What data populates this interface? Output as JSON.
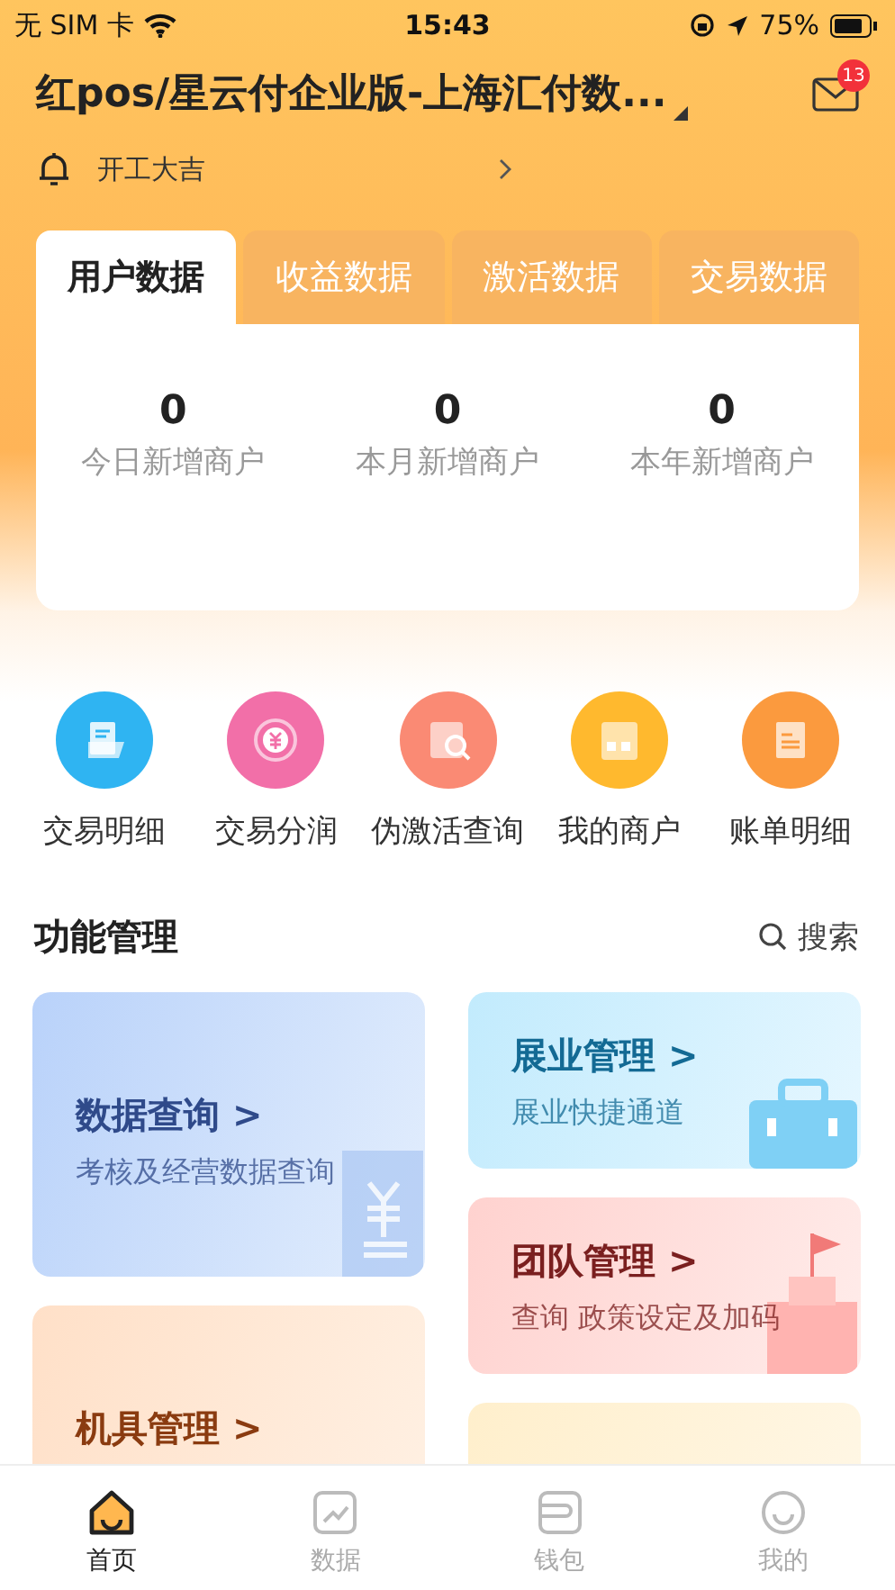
{
  "status_bar": {
    "carrier": "无 SIM 卡",
    "time": "15:43",
    "battery": "75%"
  },
  "header": {
    "title": "红pos/星云付企业版-上海汇付数...",
    "mail_badge": "13",
    "notice": "开工大吉"
  },
  "tabs": [
    {
      "label": "用户数据",
      "selected": true
    },
    {
      "label": "收益数据",
      "selected": false
    },
    {
      "label": "激活数据",
      "selected": false
    },
    {
      "label": "交易数据",
      "selected": false
    }
  ],
  "stats": [
    {
      "value": "0",
      "label": "今日新增商户"
    },
    {
      "value": "0",
      "label": "本月新增商户"
    },
    {
      "value": "0",
      "label": "本年新增商户"
    }
  ],
  "shortcuts": [
    {
      "label": "交易明细",
      "color": "#2fb4f2"
    },
    {
      "label": "交易分润",
      "color": "#f26fa8"
    },
    {
      "label": "伪激活查询",
      "color": "#fa8a74"
    },
    {
      "label": "我的商户",
      "color": "#ffb92e"
    },
    {
      "label": "账单明细",
      "color": "#fb9a3e"
    }
  ],
  "section": {
    "title": "功能管理",
    "search": "搜索"
  },
  "cards_left": [
    {
      "kind": "blue",
      "title": "数据查询 >",
      "subtitle": "考核及经营数据查询"
    },
    {
      "kind": "orange",
      "title": "机具管理 >"
    }
  ],
  "cards_right": [
    {
      "kind": "cyan",
      "title": "展业管理 >",
      "subtitle": "展业快捷通道"
    },
    {
      "kind": "red",
      "title": "团队管理 >",
      "subtitle": "查询 政策设定及加码"
    },
    {
      "kind": "yellow"
    }
  ],
  "tab_bar": [
    {
      "label": "首页",
      "selected": true
    },
    {
      "label": "数据",
      "selected": false
    },
    {
      "label": "钱包",
      "selected": false
    },
    {
      "label": "我的",
      "selected": false
    }
  ]
}
